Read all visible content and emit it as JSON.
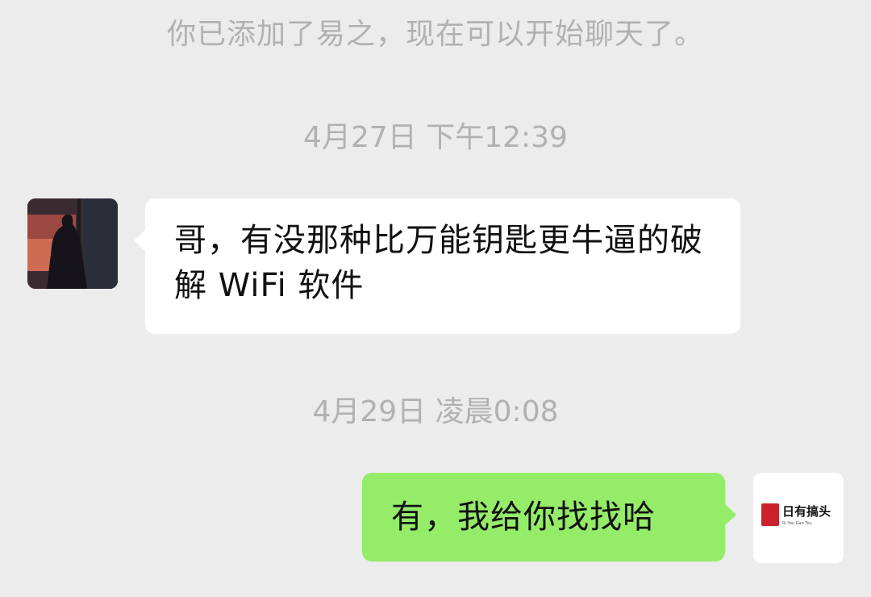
{
  "chat": {
    "system_note": "你已添加了易之，现在可以开始聊天了。",
    "messages": [
      {
        "timestamp": "4月27日 下午12:39",
        "sender": "contact",
        "text": "哥，有没那种比万能钥匙更牛逼的破解 WiFi 软件"
      },
      {
        "timestamp": "4月29日 凌晨0:08",
        "sender": "self",
        "text": "有，我给你找找哈"
      }
    ]
  },
  "avatars": {
    "contact": {
      "icon": "person-silhouette-sunset-avatar"
    },
    "self": {
      "icon": "logo-avatar",
      "logo_text": "日有搞头",
      "logo_sub": "Ri You Gao Tou"
    }
  },
  "colors": {
    "background": "#ececec",
    "incoming_bubble": "#ffffff",
    "outgoing_bubble": "#95ec69",
    "meta_text": "#b1b1b1"
  }
}
